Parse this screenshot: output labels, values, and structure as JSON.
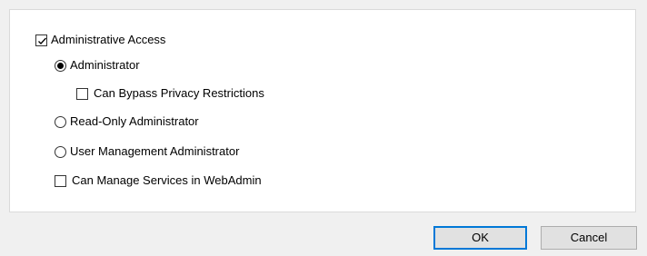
{
  "options": {
    "admin_access": {
      "label": "Administrative Access",
      "checked": true
    },
    "administrator": {
      "label": "Administrator",
      "selected": true
    },
    "bypass_privacy": {
      "label": "Can Bypass Privacy Restrictions",
      "checked": false
    },
    "read_only_admin": {
      "label": "Read-Only Administrator",
      "selected": false
    },
    "user_mgmt_admin": {
      "label": "User Management Administrator",
      "selected": false
    },
    "manage_services": {
      "label": "Can Manage Services in WebAdmin",
      "checked": false
    }
  },
  "buttons": {
    "ok_label": "OK",
    "cancel_label": "Cancel"
  },
  "colors": {
    "background": "#f0f0f0",
    "panel": "#ffffff",
    "default_button_border": "#0078d7",
    "button_face": "#e1e1e1"
  }
}
